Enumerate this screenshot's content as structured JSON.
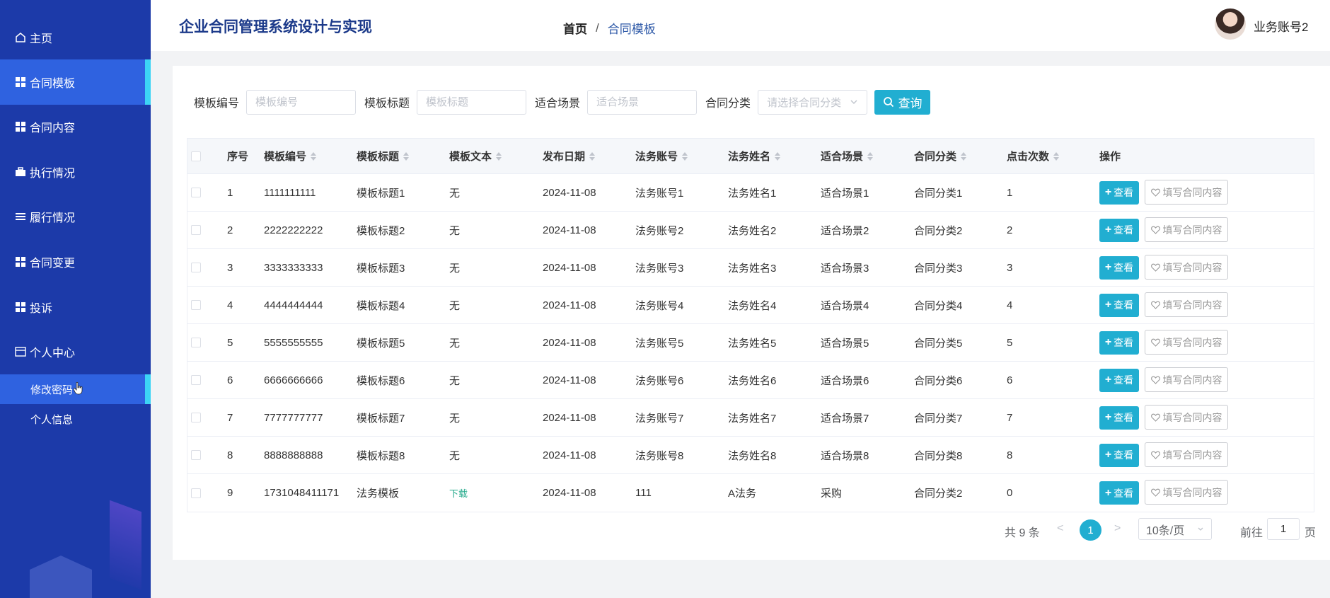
{
  "header": {
    "app_title": "企业合同管理系统设计与实现",
    "breadcrumb": {
      "home": "首页",
      "separator": "/",
      "current": "合同模板"
    },
    "user_name": "业务账号2"
  },
  "sidebar": {
    "items": [
      {
        "label": "主页",
        "icon": "home-icon"
      },
      {
        "label": "合同模板",
        "icon": "grid-icon",
        "active": true
      },
      {
        "label": "合同内容",
        "icon": "grid-icon"
      },
      {
        "label": "执行情况",
        "icon": "briefcase-icon"
      },
      {
        "label": "履行情况",
        "icon": "list-icon"
      },
      {
        "label": "合同变更",
        "icon": "grid-icon"
      },
      {
        "label": "投诉",
        "icon": "grid-icon"
      },
      {
        "label": "个人中心",
        "icon": "window-icon"
      }
    ],
    "sub_items": [
      {
        "label": "修改密码",
        "active": true
      },
      {
        "label": "个人信息"
      }
    ]
  },
  "filters": {
    "template_no": {
      "label": "模板编号",
      "placeholder": "模板编号",
      "value": ""
    },
    "template_title": {
      "label": "模板标题",
      "placeholder": "模板标题",
      "value": ""
    },
    "scene": {
      "label": "适合场景",
      "placeholder": "适合场景",
      "value": ""
    },
    "category": {
      "label": "合同分类",
      "placeholder": "请选择合同分类"
    },
    "search_label": "查询"
  },
  "table": {
    "columns": [
      "序号",
      "模板编号",
      "模板标题",
      "模板文本",
      "发布日期",
      "法务账号",
      "法务姓名",
      "适合场景",
      "合同分类",
      "点击次数",
      "操作"
    ],
    "view_label": "查看",
    "fill_label": "填写合同内容",
    "rows": [
      {
        "idx": "1",
        "no": "1111111111",
        "title": "模板标题1",
        "text": "无",
        "date": "2024-11-08",
        "account": "法务账号1",
        "name": "法务姓名1",
        "scene": "适合场景1",
        "category": "合同分类1",
        "clicks": "1"
      },
      {
        "idx": "2",
        "no": "2222222222",
        "title": "模板标题2",
        "text": "无",
        "date": "2024-11-08",
        "account": "法务账号2",
        "name": "法务姓名2",
        "scene": "适合场景2",
        "category": "合同分类2",
        "clicks": "2"
      },
      {
        "idx": "3",
        "no": "3333333333",
        "title": "模板标题3",
        "text": "无",
        "date": "2024-11-08",
        "account": "法务账号3",
        "name": "法务姓名3",
        "scene": "适合场景3",
        "category": "合同分类3",
        "clicks": "3"
      },
      {
        "idx": "4",
        "no": "4444444444",
        "title": "模板标题4",
        "text": "无",
        "date": "2024-11-08",
        "account": "法务账号4",
        "name": "法务姓名4",
        "scene": "适合场景4",
        "category": "合同分类4",
        "clicks": "4"
      },
      {
        "idx": "5",
        "no": "5555555555",
        "title": "模板标题5",
        "text": "无",
        "date": "2024-11-08",
        "account": "法务账号5",
        "name": "法务姓名5",
        "scene": "适合场景5",
        "category": "合同分类5",
        "clicks": "5"
      },
      {
        "idx": "6",
        "no": "6666666666",
        "title": "模板标题6",
        "text": "无",
        "date": "2024-11-08",
        "account": "法务账号6",
        "name": "法务姓名6",
        "scene": "适合场景6",
        "category": "合同分类6",
        "clicks": "6"
      },
      {
        "idx": "7",
        "no": "7777777777",
        "title": "模板标题7",
        "text": "无",
        "date": "2024-11-08",
        "account": "法务账号7",
        "name": "法务姓名7",
        "scene": "适合场景7",
        "category": "合同分类7",
        "clicks": "7"
      },
      {
        "idx": "8",
        "no": "8888888888",
        "title": "模板标题8",
        "text": "无",
        "date": "2024-11-08",
        "account": "法务账号8",
        "name": "法务姓名8",
        "scene": "适合场景8",
        "category": "合同分类8",
        "clicks": "8"
      },
      {
        "idx": "9",
        "no": "1731048411171",
        "title": "法务模板",
        "text": "下载",
        "text_is_link": true,
        "date": "2024-11-08",
        "account": "111",
        "name": "A法务",
        "scene": "采购",
        "category": "合同分类2",
        "clicks": "0"
      }
    ]
  },
  "pagination": {
    "total_text": "共 9 条",
    "prev": "<",
    "current_page": "1",
    "next": ">",
    "page_size": "10条/页",
    "goto_label": "前往",
    "goto_value": "1",
    "goto_unit": "页"
  },
  "colors": {
    "sidebar_bg": "#1c3aa9",
    "sidebar_active": "#2f62e0",
    "sidebar_active_bar": "#3cd4f5",
    "accent": "#21aed1",
    "title_text": "#1c3a8a",
    "download_link": "#22a98a"
  }
}
